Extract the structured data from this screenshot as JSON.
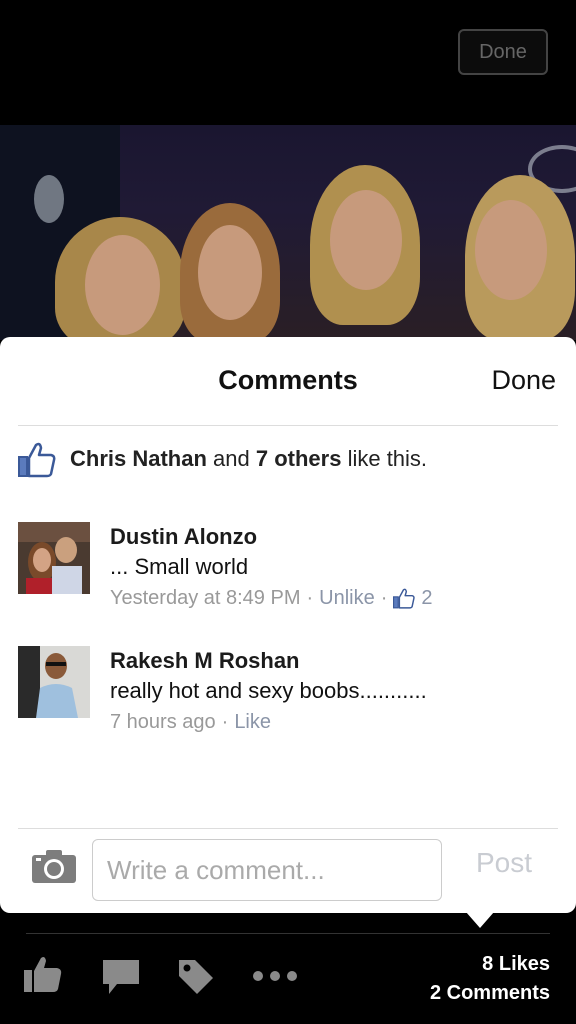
{
  "top": {
    "done_label": "Done"
  },
  "sheet": {
    "title": "Comments",
    "done_label": "Done",
    "likes": {
      "name": "Chris Nathan",
      "middle": " and ",
      "others": "7 others",
      "suffix": " like this."
    },
    "comments": [
      {
        "author": "Dustin Alonzo",
        "text": "... Small world",
        "time": "Yesterday at 8:49 PM",
        "action": "Unlike",
        "like_count": "2"
      },
      {
        "author": "Rakesh M Roshan",
        "text": "really hot and sexy boobs...........",
        "time": "7 hours ago",
        "action": "Like"
      }
    ],
    "composer": {
      "placeholder": "Write a comment...",
      "post_label": "Post"
    }
  },
  "bottom_bar": {
    "likes_count": "8 Likes",
    "comments_count": "2 Comments",
    "icons": [
      "like-icon",
      "comment-icon",
      "tag-icon",
      "more-icon"
    ]
  },
  "colors": {
    "facebook_blue": "#3b5998",
    "meta_gray": "#999999",
    "link_gray": "#8b95a8"
  }
}
